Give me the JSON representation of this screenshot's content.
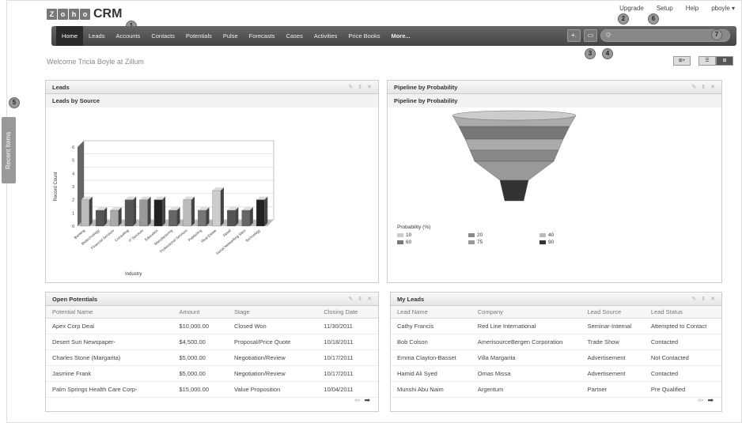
{
  "app": {
    "logo_letters": [
      "Z",
      "o",
      "h",
      "o"
    ],
    "title": "CRM"
  },
  "toplinks": [
    "Upgrade",
    "Setup",
    "Help",
    "pboyle ▾"
  ],
  "nav": [
    "Home",
    "Leads",
    "Accounts",
    "Contacts",
    "Potentials",
    "Pulse",
    "Forecasts",
    "Cases",
    "Activities",
    "Price Books",
    "More..."
  ],
  "search": {
    "placeholder": "Q-"
  },
  "nav_buttons": [
    "+.",
    "▭"
  ],
  "callouts": [
    "1",
    "2",
    "3",
    "4",
    "5",
    "6",
    "7"
  ],
  "welcome": "Welcome Tricia Boyle at Zillum",
  "view_tools": [
    "⊞+",
    "☰",
    "⊞"
  ],
  "recent_items": "Recent Items",
  "leads_panel": {
    "title": "Leads",
    "subtitle": "Leads by Source",
    "icons": [
      "✎",
      "⇕",
      "✕"
    ]
  },
  "pipeline_panel": {
    "title": "Pipeline by Probability",
    "subtitle": "Pipeline by Probability",
    "icons": [
      "✎",
      "⇕",
      "✕"
    ],
    "legend_title": "Probability (%)",
    "legend": [
      {
        "label": "10",
        "color": "#ccc"
      },
      {
        "label": "20",
        "color": "#888"
      },
      {
        "label": "40",
        "color": "#bbb"
      },
      {
        "label": "60",
        "color": "#777"
      },
      {
        "label": "75",
        "color": "#999"
      },
      {
        "label": "90",
        "color": "#333"
      }
    ]
  },
  "chart_data": {
    "type": "bar",
    "xlabel": "Industry",
    "ylabel": "Record Count",
    "ylim": [
      0,
      6
    ],
    "yticks": [
      "0",
      "1",
      "2",
      "3",
      "4",
      "5",
      "6"
    ],
    "categories": [
      "Banking",
      "Biotechnology",
      "Financial Services",
      "Consulting",
      "IT Services",
      "Education",
      "Manufacturing",
      "Professional Services",
      "Publishing",
      "Real Estate",
      "Retail",
      "Social Networking Sites",
      "Technology"
    ],
    "values": [
      2,
      1.2,
      1.2,
      2,
      2,
      2,
      1.2,
      2,
      1.2,
      2.7,
      1.2,
      1.2,
      2
    ],
    "colors": [
      "#bbb",
      "#555",
      "#aaa",
      "#555",
      "#999",
      "#222",
      "#666",
      "#bbb",
      "#777",
      "#ccc",
      "#555",
      "#666",
      "#222"
    ]
  },
  "funnel": {
    "layers": [
      {
        "color": "#aaa"
      },
      {
        "color": "#777"
      },
      {
        "color": "#aaa"
      },
      {
        "color": "#888"
      },
      {
        "color": "#999"
      },
      {
        "color": "#333"
      }
    ]
  },
  "potentials_panel": {
    "title": "Open Potentials",
    "icons": [
      "✎",
      "⇕",
      "✕"
    ],
    "columns": [
      "Potential Name",
      "Amount",
      "Stage",
      "Closing Date"
    ],
    "rows": [
      [
        "Apex Corp Deal",
        "$10,000.00",
        "Closed Won",
        "11/30/2011"
      ],
      [
        "Desert Sun Newspaper-",
        "$4,500.00",
        "Proposal/Price Quote",
        "10/18/2011"
      ],
      [
        "Charles Stone (Margarita)",
        "$5,000.00",
        "Negotiation/Review",
        "10/17/2011"
      ],
      [
        "Jasmine Frank",
        "$5,000.00",
        "Negotiation/Review",
        "10/17/2011"
      ],
      [
        "Palm Springs Health Care Corp-",
        "$15,000.00",
        "Value Proposition",
        "10/04/2011"
      ]
    ]
  },
  "myleads_panel": {
    "title": "My Leads",
    "icons": [
      "✎",
      "⇕",
      "✕"
    ],
    "columns": [
      "Lead Name",
      "Company",
      "Lead Source",
      "Lead Status"
    ],
    "rows": [
      [
        "Cathy Francis",
        "Red Line International",
        "Seminar-Internal",
        "Attempted to Contact"
      ],
      [
        "Bob Colson",
        "AmerisourceBergen Corporation",
        "Trade Show",
        "Contacted"
      ],
      [
        "Emma Clayton-Basset",
        "Villa Margarita",
        "Advertisement",
        "Not Contacted"
      ],
      [
        "Hamid Ali Syed",
        "Omas Missa",
        "Advertisement",
        "Contacted"
      ],
      [
        "Munshi Abu Naim",
        "Argentum",
        "Partner",
        "Pre Qualified"
      ]
    ]
  },
  "pager": [
    "⇦",
    "➡"
  ]
}
